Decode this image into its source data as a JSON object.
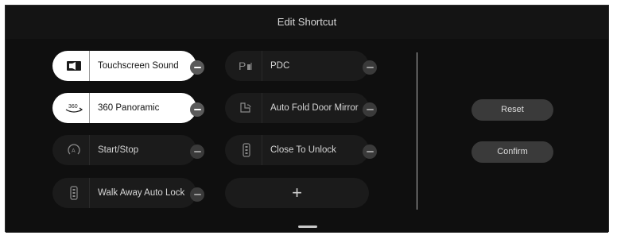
{
  "header": {
    "title": "Edit Shortcut"
  },
  "shortcuts": [
    {
      "label": "Touchscreen Sound",
      "icon": "speaker-icon",
      "selected": true
    },
    {
      "label": "360 Panoramic",
      "icon": "360-camera-icon",
      "selected": true
    },
    {
      "label": "Start/Stop",
      "icon": "auto-start-stop-icon",
      "selected": false
    },
    {
      "label": "Walk Away Auto Lock",
      "icon": "key-fob-icon",
      "selected": false
    },
    {
      "label": "PDC",
      "icon": "parking-sensor-icon",
      "selected": false
    },
    {
      "label": "Auto Fold Door Mirror",
      "icon": "mirror-fold-icon",
      "selected": false
    },
    {
      "label": "Close To Unlock",
      "icon": "key-fob-icon",
      "selected": false
    }
  ],
  "add_shortcut": {
    "label": "+"
  },
  "actions": {
    "reset_label": "Reset",
    "confirm_label": "Confirm"
  }
}
